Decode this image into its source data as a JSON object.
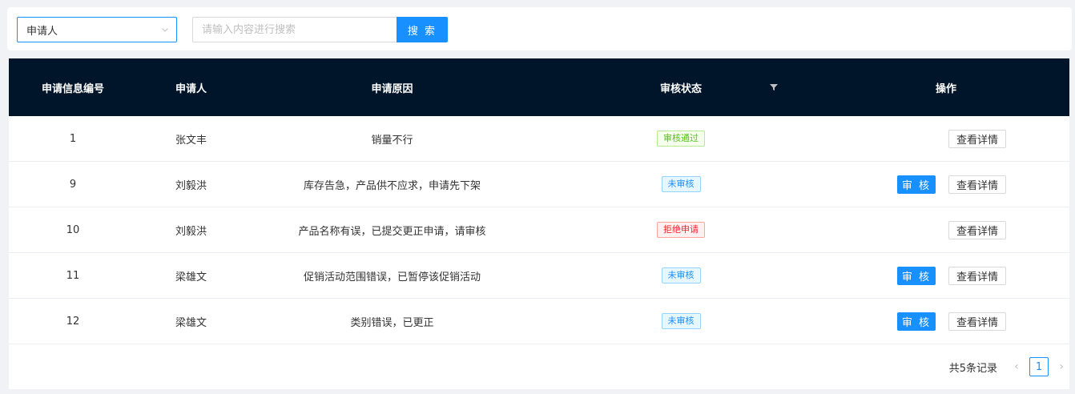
{
  "search": {
    "select_value": "申请人",
    "placeholder": "请输入内容进行搜索",
    "button_label": "搜 索"
  },
  "table": {
    "headers": [
      "申请信息编号",
      "申请人",
      "申请原因",
      "审核状态",
      "操作"
    ],
    "rows": [
      {
        "id": "1",
        "applicant": "张文丰",
        "reason": "销量不行",
        "status": "审核通过",
        "status_type": "pass",
        "can_audit": false
      },
      {
        "id": "9",
        "applicant": "刘毅洪",
        "reason": "库存告急，产品供不应求，申请先下架",
        "status": "未审核",
        "status_type": "pending",
        "can_audit": true
      },
      {
        "id": "10",
        "applicant": "刘毅洪",
        "reason": "产品名称有误，已提交更正申请，请审核",
        "status": "拒绝申请",
        "status_type": "reject",
        "can_audit": false
      },
      {
        "id": "11",
        "applicant": "梁雄文",
        "reason": "促销活动范围错误，已暂停该促销活动",
        "status": "未审核",
        "status_type": "pending",
        "can_audit": true
      },
      {
        "id": "12",
        "applicant": "梁雄文",
        "reason": "类别错误，已更正",
        "status": "未审核",
        "status_type": "pending",
        "can_audit": true
      }
    ],
    "audit_label": "审 核",
    "detail_label": "查看详情"
  },
  "pagination": {
    "total_text": "共5条记录",
    "current_page": "1"
  },
  "colors": {
    "primary": "#1890ff",
    "header_bg": "#001529"
  }
}
